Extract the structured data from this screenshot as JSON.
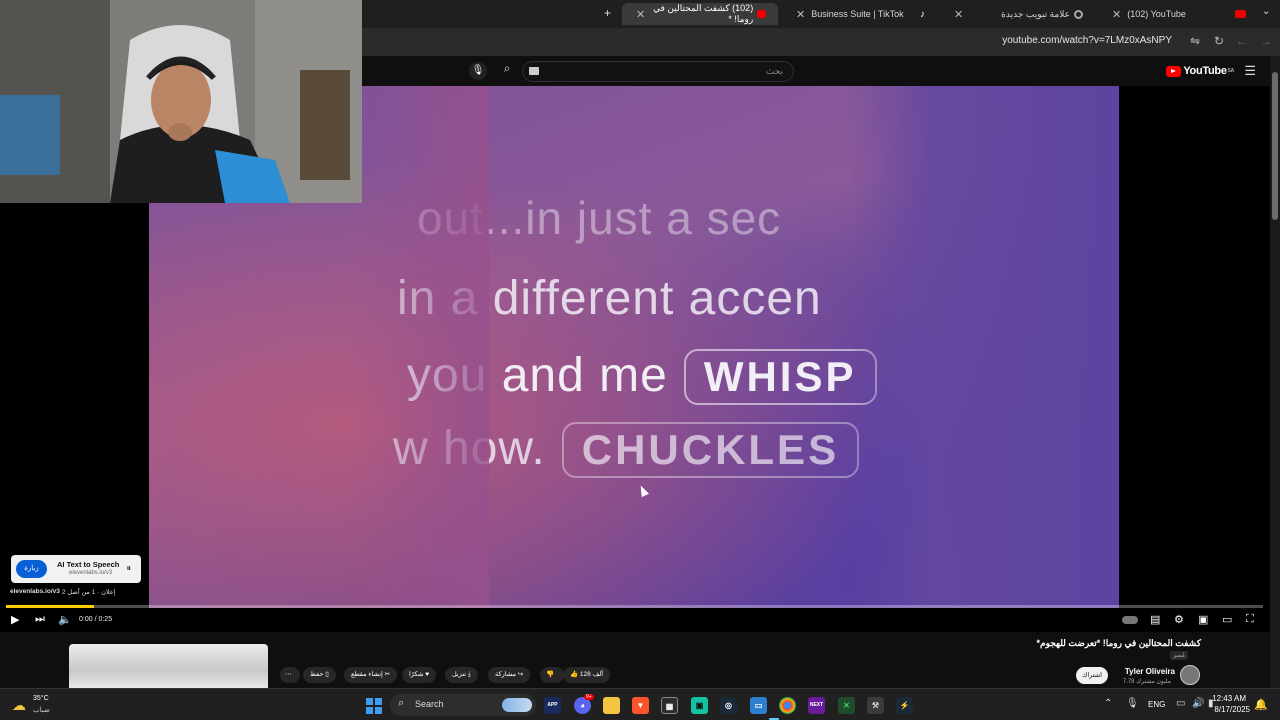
{
  "browser": {
    "tabs": [
      {
        "label": "(102) YouTube",
        "active": false
      },
      {
        "label": "علامة تبويب جديدة",
        "active": false
      },
      {
        "label": "Business Suite | TikTok",
        "active": false
      },
      {
        "label": "(102) كشفت المحتالين في روما! *",
        "active": true
      }
    ],
    "new_tab": "+",
    "url": "youtube.com/watch?v=7LMz0xAsNPY"
  },
  "youtube": {
    "logo": "YouTube",
    "logo_region": "SA",
    "search_placeholder": "بحث",
    "search_value": ""
  },
  "video": {
    "lines": [
      "out...in just a sec",
      "in a different accen",
      "you and me",
      "w how."
    ],
    "pills": [
      "WHISP",
      "CHUCKLES"
    ]
  },
  "ad": {
    "visit_label": "زيارة",
    "title": "AI Text to Speech",
    "domain": "elevenlabs.io/v3",
    "link": "elevenlabs.io/v3",
    "label": "إعلان · 1 من أصل 2"
  },
  "player": {
    "time": "0:00 / 0:25",
    "progress": 0.07
  },
  "details": {
    "title": "كشفت المحتالين في روما! *تعرضت للهجوم*",
    "sub_badge": "مُميز",
    "channel": "Tyler Oliveira",
    "subscribers": "7.78 مليون مشترك",
    "subscribe": "اشتراك",
    "likes": "128 ألف",
    "share": "مشاركة",
    "download": "تنزيل",
    "thanks": "شكرًا",
    "clip": "إنشاء مقطع",
    "save": "حفظ",
    "more": "⋯"
  },
  "taskbar": {
    "temp": "35°C",
    "weather_desc": "ضباب",
    "search_label": "Search",
    "lang": "ENG",
    "time": "12:43 AM",
    "date": "8/17/2025",
    "discord_badge": "9+"
  },
  "colors": {
    "accent": "#065fd4",
    "progress": "#ffcc00",
    "yt_red": "#ff0000"
  }
}
